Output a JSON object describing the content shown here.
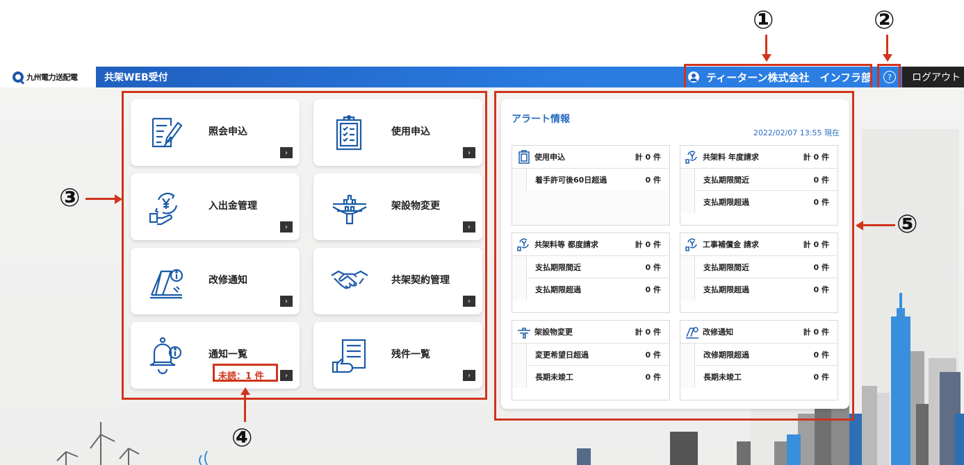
{
  "logo": {
    "text": "九州電力送配電"
  },
  "header": {
    "title": "共架WEB受付",
    "user": "ティーターン株式会社　インフラ部",
    "help": "?",
    "logout": "ログアウト"
  },
  "annotations": {
    "a1": "①",
    "a2": "②",
    "a3": "③",
    "a4": "④",
    "a5": "⑤"
  },
  "menu": {
    "inquiry": "照会申込",
    "usage": "使用申込",
    "payment": "入出金管理",
    "structure": "架設物変更",
    "repair": "改修通知",
    "contract": "共架契約管理",
    "notice": "通知一覧",
    "unread": "未読：1 件",
    "remaining": "残件一覧",
    "go": "›"
  },
  "alert": {
    "title": "アラート情報",
    "timestamp": "2022/02/07 13:55 現在",
    "groups": [
      {
        "name": "使用申込",
        "total": "計 0 件",
        "rows": [
          {
            "label": "着手許可後60日超過",
            "value": "0 件"
          }
        ]
      },
      {
        "name": "共架料 年度請求",
        "total": "計 0 件",
        "rows": [
          {
            "label": "支払期限間近",
            "value": "0 件"
          },
          {
            "label": "支払期限超過",
            "value": "0 件"
          }
        ]
      },
      {
        "name": "共架料等 都度請求",
        "total": "計 0 件",
        "rows": [
          {
            "label": "支払期限間近",
            "value": "0 件"
          },
          {
            "label": "支払期限超過",
            "value": "0 件"
          }
        ]
      },
      {
        "name": "工事補償金 請求",
        "total": "計 0 件",
        "rows": [
          {
            "label": "支払期限間近",
            "value": "0 件"
          },
          {
            "label": "支払期限超過",
            "value": "0 件"
          }
        ]
      },
      {
        "name": "架設物変更",
        "total": "計 0 件",
        "rows": [
          {
            "label": "変更希望日超過",
            "value": "0 件"
          },
          {
            "label": "長期未竣工",
            "value": "0 件"
          }
        ]
      },
      {
        "name": "改修通知",
        "total": "計 0 件",
        "rows": [
          {
            "label": "改修期限超過",
            "value": "0 件"
          },
          {
            "label": "長期未竣工",
            "value": "0 件"
          }
        ]
      }
    ]
  },
  "colors": {
    "primary": "#2a6dc2",
    "annotation": "#d0341c",
    "header_dark": "#222222"
  }
}
